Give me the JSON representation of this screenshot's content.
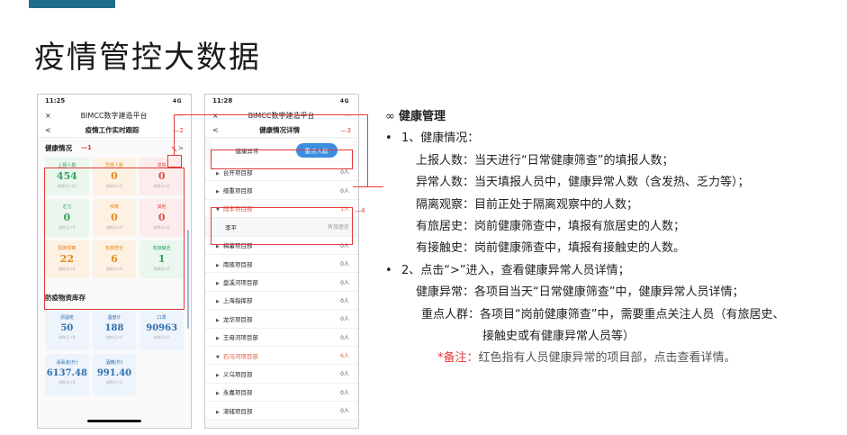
{
  "slide": {
    "title": "疫情管控大数据"
  },
  "phone_a": {
    "time": "11:25",
    "signal": "4G",
    "app_title": "BIMCC数字建造平台",
    "close": "×",
    "more": "···",
    "back": "<",
    "nav_title": "疫情工作实时跟踪",
    "marker_nav": "—2",
    "section_title": "健康情况",
    "marker_section": "—1",
    "detail_arrow": ">",
    "health": [
      {
        "label": "上报人数",
        "value": "454",
        "sub": "较昨日+23",
        "tone": "t-green"
      },
      {
        "label": "异常人数",
        "value": "0",
        "sub": "较昨日+0",
        "tone": "t-orange"
      },
      {
        "label": "发热",
        "value": "0",
        "sub": "较昨日+0",
        "tone": "t-red"
      },
      {
        "label": "乏力",
        "value": "0",
        "sub": "较昨日+0",
        "tone": "t-green"
      },
      {
        "label": "咳嗽",
        "value": "0",
        "sub": "较昨日+0",
        "tone": "t-orange"
      },
      {
        "label": "其他",
        "value": "0",
        "sub": "较昨日+0",
        "tone": "t-red"
      },
      {
        "label": "隔离观察",
        "value": "22",
        "sub": "较昨日+0",
        "tone": "t-orange"
      },
      {
        "label": "有旅居史",
        "value": "6",
        "sub": "较昨日+0",
        "tone": "t-orange"
      },
      {
        "label": "有接触史",
        "value": "1",
        "sub": "较昨日+0",
        "tone": "t-green"
      }
    ],
    "supply_title": "防疫物资库存",
    "supplies": [
      {
        "label": "测温枪",
        "value": "50",
        "sub": "较昨日+0"
      },
      {
        "label": "温度计",
        "value": "188",
        "sub": "较昨日+0"
      },
      {
        "label": "口罩",
        "value": "90963",
        "sub": "较昨日+0"
      },
      {
        "label": "消毒液(升)",
        "value": "6137.48",
        "sub": "较昨日+0"
      },
      {
        "label": "酒精(升)",
        "value": "991.40",
        "sub": "较昨日+0"
      }
    ]
  },
  "phone_b": {
    "time": "11:28",
    "signal": "4G",
    "app_title": "BIMCC数字建造平台",
    "close": "×",
    "more": "···",
    "back": "<",
    "nav_title": "健康情况详情",
    "marker_nav": "—3",
    "tabs": [
      "健康异常",
      "重点人群"
    ],
    "marker_detail": "—4",
    "projects": [
      {
        "name": "台开项目部",
        "count": "0人",
        "alert": false,
        "sub": false
      },
      {
        "name": "缙重项目部",
        "count": "0人",
        "alert": false,
        "sub": false
      },
      {
        "name": "陆丰项目部",
        "count": "1人",
        "alert": true,
        "sub": false
      },
      {
        "name": "李平",
        "count": "有旅居史",
        "alert": false,
        "sub": true
      },
      {
        "name": "梅薯项目部",
        "count": "0人",
        "alert": false,
        "sub": false
      },
      {
        "name": "南陵项目部",
        "count": "0人",
        "alert": false,
        "sub": false
      },
      {
        "name": "盘溪河项目部",
        "count": "0人",
        "alert": false,
        "sub": false
      },
      {
        "name": "上海指挥部",
        "count": "0人",
        "alert": false,
        "sub": false
      },
      {
        "name": "龙华项目部",
        "count": "0人",
        "alert": false,
        "sub": false
      },
      {
        "name": "王母河项目部",
        "count": "0人",
        "alert": false,
        "sub": false
      },
      {
        "name": "石马河项目部",
        "count": "6人",
        "alert": true,
        "sub": false
      },
      {
        "name": "义乌项目部",
        "count": "0人",
        "alert": false,
        "sub": false
      },
      {
        "name": "永嘉项目部",
        "count": "0人",
        "alert": false,
        "sub": false
      },
      {
        "name": "湛储项目部",
        "count": "0人",
        "alert": false,
        "sub": false
      }
    ]
  },
  "notes": {
    "heading": "健康管理",
    "heading_icon": "∞",
    "bullet": "•",
    "item1": "1、健康情况：",
    "lines1": [
      "上报人数：当天进行“日常健康筛查”的填报人数；",
      "异常人数：当天填报人员中，健康异常人数（含发热、乏力等）；",
      "隔离观察：目前正处于隔离观察中的人数；",
      "有旅居史：岗前健康筛查中，填报有旅居史的人数；",
      "有接触史：岗前健康筛查中，填报有接触史的人数。"
    ],
    "item2": "2、点击“>”进入，查看健康异常人员详情；",
    "lines2": [
      "健康异常：各项目当天“日常健康筛查”中，健康异常人员详情；",
      "重点人群：各项目“岗前健康筛查”中，需要重点关注人员（有旅居史、",
      "接触史或有健康异常人员等）"
    ],
    "note_label": "*备注：",
    "note_text": "红色指有人员健康异常的项目部，点击查看详情。"
  }
}
